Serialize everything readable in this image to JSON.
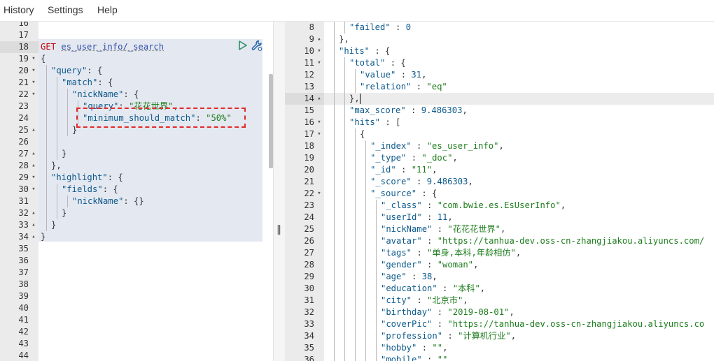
{
  "menu": {
    "history": "History",
    "settings": "Settings",
    "help": "Help"
  },
  "icons": {
    "run": "play-icon",
    "settings": "wrench-icon",
    "resize": "drag-handle-icon"
  },
  "colors": {
    "method": "#c5060b",
    "key": "#0d5a8c",
    "string": "#1e7d1e",
    "highlight_border": "#e12b2b"
  },
  "request": {
    "method": "GET",
    "path": "es_user_info/_search",
    "lines": [
      {
        "n": "16",
        "fold": "",
        "indent": 0,
        "guides": [],
        "parts": []
      },
      {
        "n": "17",
        "fold": "",
        "indent": 0,
        "guides": [],
        "parts": []
      },
      {
        "n": "18",
        "fold": "",
        "indent": 0,
        "guides": [],
        "active": true,
        "parts": [
          {
            "t": "GET",
            "c": "method"
          },
          {
            "t": " ",
            "c": "pun"
          },
          {
            "t": "es_user_info/_search",
            "c": "url"
          }
        ]
      },
      {
        "n": "19",
        "fold": "▾",
        "indent": 0,
        "guides": [],
        "parts": [
          {
            "t": "{",
            "c": "pun"
          }
        ]
      },
      {
        "n": "20",
        "fold": "▾",
        "indent": 1,
        "guides": [
          0
        ],
        "parts": [
          {
            "t": "\"query\"",
            "c": "key"
          },
          {
            "t": ": {",
            "c": "pun"
          }
        ]
      },
      {
        "n": "21",
        "fold": "▾",
        "indent": 2,
        "guides": [
          0,
          1
        ],
        "parts": [
          {
            "t": "\"match\"",
            "c": "key"
          },
          {
            "t": ": {",
            "c": "pun"
          }
        ]
      },
      {
        "n": "22",
        "fold": "▾",
        "indent": 3,
        "guides": [
          0,
          1,
          2
        ],
        "parts": [
          {
            "t": "\"nickName\"",
            "c": "key"
          },
          {
            "t": ": {",
            "c": "pun"
          }
        ]
      },
      {
        "n": "23",
        "fold": "",
        "indent": 4,
        "guides": [
          0,
          1,
          2,
          3
        ],
        "parts": [
          {
            "t": "\"query\"",
            "c": "key"
          },
          {
            "t": ": ",
            "c": "pun"
          },
          {
            "t": "\"花花世界\"",
            "c": "str"
          },
          {
            "t": ",",
            "c": "pun"
          }
        ]
      },
      {
        "n": "24",
        "fold": "",
        "indent": 4,
        "guides": [
          0,
          1,
          2,
          3
        ],
        "parts": [
          {
            "t": "\"minimum_should_match\"",
            "c": "key"
          },
          {
            "t": ": ",
            "c": "pun"
          },
          {
            "t": "\"50%\"",
            "c": "str"
          }
        ]
      },
      {
        "n": "25",
        "fold": "▴",
        "indent": 3,
        "guides": [
          0,
          1,
          2
        ],
        "parts": [
          {
            "t": "}",
            "c": "pun"
          }
        ]
      },
      {
        "n": "26",
        "fold": "",
        "indent": 0,
        "guides": [
          0,
          1
        ],
        "parts": []
      },
      {
        "n": "27",
        "fold": "▴",
        "indent": 2,
        "guides": [
          0,
          1
        ],
        "parts": [
          {
            "t": "}",
            "c": "pun"
          }
        ]
      },
      {
        "n": "28",
        "fold": "▴",
        "indent": 1,
        "guides": [
          0
        ],
        "parts": [
          {
            "t": "},",
            "c": "pun"
          }
        ]
      },
      {
        "n": "29",
        "fold": "▾",
        "indent": 1,
        "guides": [
          0
        ],
        "parts": [
          {
            "t": "\"highlight\"",
            "c": "key"
          },
          {
            "t": ": {",
            "c": "pun"
          }
        ]
      },
      {
        "n": "30",
        "fold": "▾",
        "indent": 2,
        "guides": [
          0,
          1
        ],
        "parts": [
          {
            "t": "\"fields\"",
            "c": "key"
          },
          {
            "t": ": {",
            "c": "pun"
          }
        ]
      },
      {
        "n": "31",
        "fold": "",
        "indent": 3,
        "guides": [
          0,
          1,
          2
        ],
        "parts": [
          {
            "t": "\"nickName\"",
            "c": "key"
          },
          {
            "t": ": {}",
            "c": "pun"
          }
        ]
      },
      {
        "n": "32",
        "fold": "▴",
        "indent": 2,
        "guides": [
          0,
          1
        ],
        "parts": [
          {
            "t": "}",
            "c": "pun"
          }
        ]
      },
      {
        "n": "33",
        "fold": "▴",
        "indent": 1,
        "guides": [
          0
        ],
        "parts": [
          {
            "t": "}",
            "c": "pun"
          }
        ]
      },
      {
        "n": "34",
        "fold": "▴",
        "indent": 0,
        "guides": [],
        "parts": [
          {
            "t": "}",
            "c": "pun"
          }
        ]
      },
      {
        "n": "35",
        "fold": "",
        "indent": 0,
        "guides": [],
        "parts": []
      },
      {
        "n": "36",
        "fold": "",
        "indent": 0,
        "guides": [],
        "parts": []
      },
      {
        "n": "37",
        "fold": "",
        "indent": 0,
        "guides": [],
        "parts": []
      },
      {
        "n": "38",
        "fold": "",
        "indent": 0,
        "guides": [],
        "parts": []
      },
      {
        "n": "39",
        "fold": "",
        "indent": 0,
        "guides": [],
        "parts": []
      },
      {
        "n": "40",
        "fold": "",
        "indent": 0,
        "guides": [],
        "parts": []
      },
      {
        "n": "41",
        "fold": "",
        "indent": 0,
        "guides": [],
        "parts": []
      },
      {
        "n": "42",
        "fold": "",
        "indent": 0,
        "guides": [],
        "parts": []
      },
      {
        "n": "43",
        "fold": "",
        "indent": 0,
        "guides": [],
        "parts": []
      },
      {
        "n": "44",
        "fold": "",
        "indent": 0,
        "guides": [],
        "parts": []
      }
    ]
  },
  "response": {
    "lines": [
      {
        "n": "8",
        "fold": "",
        "indent": 2,
        "guides": [
          0,
          1
        ],
        "parts": [
          {
            "t": "\"failed\"",
            "c": "key"
          },
          {
            "t": " : ",
            "c": "pun"
          },
          {
            "t": "0",
            "c": "num"
          }
        ]
      },
      {
        "n": "9",
        "fold": "▴",
        "indent": 1,
        "guides": [
          0
        ],
        "parts": [
          {
            "t": "},",
            "c": "pun"
          }
        ]
      },
      {
        "n": "10",
        "fold": "▾",
        "indent": 1,
        "guides": [
          0
        ],
        "parts": [
          {
            "t": "\"hits\"",
            "c": "key"
          },
          {
            "t": " : {",
            "c": "pun"
          }
        ]
      },
      {
        "n": "11",
        "fold": "▾",
        "indent": 2,
        "guides": [
          0,
          1
        ],
        "parts": [
          {
            "t": "\"total\"",
            "c": "key"
          },
          {
            "t": " : {",
            "c": "pun"
          }
        ]
      },
      {
        "n": "12",
        "fold": "",
        "indent": 3,
        "guides": [
          0,
          1,
          2
        ],
        "parts": [
          {
            "t": "\"value\"",
            "c": "key"
          },
          {
            "t": " : ",
            "c": "pun"
          },
          {
            "t": "31",
            "c": "num"
          },
          {
            "t": ",",
            "c": "pun"
          }
        ]
      },
      {
        "n": "13",
        "fold": "",
        "indent": 3,
        "guides": [
          0,
          1,
          2
        ],
        "parts": [
          {
            "t": "\"relation\"",
            "c": "key"
          },
          {
            "t": " : ",
            "c": "pun"
          },
          {
            "t": "\"eq\"",
            "c": "str"
          }
        ]
      },
      {
        "n": "14",
        "fold": "▴",
        "indent": 2,
        "guides": [
          0,
          1
        ],
        "active": true,
        "parts": [
          {
            "t": "},",
            "c": "pun"
          }
        ]
      },
      {
        "n": "15",
        "fold": "",
        "indent": 2,
        "guides": [
          0,
          1
        ],
        "parts": [
          {
            "t": "\"max_score\"",
            "c": "key"
          },
          {
            "t": " : ",
            "c": "pun"
          },
          {
            "t": "9.486303",
            "c": "num"
          },
          {
            "t": ",",
            "c": "pun"
          }
        ]
      },
      {
        "n": "16",
        "fold": "▾",
        "indent": 2,
        "guides": [
          0,
          1
        ],
        "parts": [
          {
            "t": "\"hits\"",
            "c": "key"
          },
          {
            "t": " : [",
            "c": "pun"
          }
        ]
      },
      {
        "n": "17",
        "fold": "▾",
        "indent": 3,
        "guides": [
          0,
          1,
          2
        ],
        "parts": [
          {
            "t": "{",
            "c": "pun"
          }
        ]
      },
      {
        "n": "18",
        "fold": "",
        "indent": 4,
        "guides": [
          0,
          1,
          2,
          3
        ],
        "parts": [
          {
            "t": "\"_index\"",
            "c": "key"
          },
          {
            "t": " : ",
            "c": "pun"
          },
          {
            "t": "\"es_user_info\"",
            "c": "str"
          },
          {
            "t": ",",
            "c": "pun"
          }
        ]
      },
      {
        "n": "19",
        "fold": "",
        "indent": 4,
        "guides": [
          0,
          1,
          2,
          3
        ],
        "parts": [
          {
            "t": "\"_type\"",
            "c": "key"
          },
          {
            "t": " : ",
            "c": "pun"
          },
          {
            "t": "\"_doc\"",
            "c": "str"
          },
          {
            "t": ",",
            "c": "pun"
          }
        ]
      },
      {
        "n": "20",
        "fold": "",
        "indent": 4,
        "guides": [
          0,
          1,
          2,
          3
        ],
        "parts": [
          {
            "t": "\"_id\"",
            "c": "key"
          },
          {
            "t": " : ",
            "c": "pun"
          },
          {
            "t": "\"11\"",
            "c": "str"
          },
          {
            "t": ",",
            "c": "pun"
          }
        ]
      },
      {
        "n": "21",
        "fold": "",
        "indent": 4,
        "guides": [
          0,
          1,
          2,
          3
        ],
        "parts": [
          {
            "t": "\"_score\"",
            "c": "key"
          },
          {
            "t": " : ",
            "c": "pun"
          },
          {
            "t": "9.486303",
            "c": "num"
          },
          {
            "t": ",",
            "c": "pun"
          }
        ]
      },
      {
        "n": "22",
        "fold": "▾",
        "indent": 4,
        "guides": [
          0,
          1,
          2,
          3
        ],
        "parts": [
          {
            "t": "\"_source\"",
            "c": "key"
          },
          {
            "t": " : {",
            "c": "pun"
          }
        ]
      },
      {
        "n": "23",
        "fold": "",
        "indent": 5,
        "guides": [
          0,
          1,
          2,
          3,
          4
        ],
        "parts": [
          {
            "t": "\"_class\"",
            "c": "key"
          },
          {
            "t": " : ",
            "c": "pun"
          },
          {
            "t": "\"com.bwie.es.EsUserInfo\"",
            "c": "str"
          },
          {
            "t": ",",
            "c": "pun"
          }
        ]
      },
      {
        "n": "24",
        "fold": "",
        "indent": 5,
        "guides": [
          0,
          1,
          2,
          3,
          4
        ],
        "parts": [
          {
            "t": "\"userId\"",
            "c": "key"
          },
          {
            "t": " : ",
            "c": "pun"
          },
          {
            "t": "11",
            "c": "num"
          },
          {
            "t": ",",
            "c": "pun"
          }
        ]
      },
      {
        "n": "25",
        "fold": "",
        "indent": 5,
        "guides": [
          0,
          1,
          2,
          3,
          4
        ],
        "parts": [
          {
            "t": "\"nickName\"",
            "c": "key"
          },
          {
            "t": " : ",
            "c": "pun"
          },
          {
            "t": "\"花花花世界\"",
            "c": "str"
          },
          {
            "t": ",",
            "c": "pun"
          }
        ]
      },
      {
        "n": "26",
        "fold": "",
        "indent": 5,
        "guides": [
          0,
          1,
          2,
          3,
          4
        ],
        "parts": [
          {
            "t": "\"avatar\"",
            "c": "key"
          },
          {
            "t": " : ",
            "c": "pun"
          },
          {
            "t": "\"https://tanhua-dev.oss-cn-zhangjiakou.aliyuncs.com/",
            "c": "str"
          }
        ]
      },
      {
        "n": "27",
        "fold": "",
        "indent": 5,
        "guides": [
          0,
          1,
          2,
          3,
          4
        ],
        "parts": [
          {
            "t": "\"tags\"",
            "c": "key"
          },
          {
            "t": " : ",
            "c": "pun"
          },
          {
            "t": "\"单身,本科,年龄相仿\"",
            "c": "str"
          },
          {
            "t": ",",
            "c": "pun"
          }
        ]
      },
      {
        "n": "28",
        "fold": "",
        "indent": 5,
        "guides": [
          0,
          1,
          2,
          3,
          4
        ],
        "parts": [
          {
            "t": "\"gender\"",
            "c": "key"
          },
          {
            "t": " : ",
            "c": "pun"
          },
          {
            "t": "\"woman\"",
            "c": "str"
          },
          {
            "t": ",",
            "c": "pun"
          }
        ]
      },
      {
        "n": "29",
        "fold": "",
        "indent": 5,
        "guides": [
          0,
          1,
          2,
          3,
          4
        ],
        "parts": [
          {
            "t": "\"age\"",
            "c": "key"
          },
          {
            "t": " : ",
            "c": "pun"
          },
          {
            "t": "38",
            "c": "num"
          },
          {
            "t": ",",
            "c": "pun"
          }
        ]
      },
      {
        "n": "30",
        "fold": "",
        "indent": 5,
        "guides": [
          0,
          1,
          2,
          3,
          4
        ],
        "parts": [
          {
            "t": "\"education\"",
            "c": "key"
          },
          {
            "t": " : ",
            "c": "pun"
          },
          {
            "t": "\"本科\"",
            "c": "str"
          },
          {
            "t": ",",
            "c": "pun"
          }
        ]
      },
      {
        "n": "31",
        "fold": "",
        "indent": 5,
        "guides": [
          0,
          1,
          2,
          3,
          4
        ],
        "parts": [
          {
            "t": "\"city\"",
            "c": "key"
          },
          {
            "t": " : ",
            "c": "pun"
          },
          {
            "t": "\"北京市\"",
            "c": "str"
          },
          {
            "t": ",",
            "c": "pun"
          }
        ]
      },
      {
        "n": "32",
        "fold": "",
        "indent": 5,
        "guides": [
          0,
          1,
          2,
          3,
          4
        ],
        "parts": [
          {
            "t": "\"birthday\"",
            "c": "key"
          },
          {
            "t": " : ",
            "c": "pun"
          },
          {
            "t": "\"2019-08-01\"",
            "c": "str"
          },
          {
            "t": ",",
            "c": "pun"
          }
        ]
      },
      {
        "n": "33",
        "fold": "",
        "indent": 5,
        "guides": [
          0,
          1,
          2,
          3,
          4
        ],
        "parts": [
          {
            "t": "\"coverPic\"",
            "c": "key"
          },
          {
            "t": " : ",
            "c": "pun"
          },
          {
            "t": "\"https://tanhua-dev.oss-cn-zhangjiakou.aliyuncs.co",
            "c": "str"
          }
        ]
      },
      {
        "n": "34",
        "fold": "",
        "indent": 5,
        "guides": [
          0,
          1,
          2,
          3,
          4
        ],
        "parts": [
          {
            "t": "\"profession\"",
            "c": "key"
          },
          {
            "t": " : ",
            "c": "pun"
          },
          {
            "t": "\"计算机行业\"",
            "c": "str"
          },
          {
            "t": ",",
            "c": "pun"
          }
        ]
      },
      {
        "n": "35",
        "fold": "",
        "indent": 5,
        "guides": [
          0,
          1,
          2,
          3,
          4
        ],
        "parts": [
          {
            "t": "\"hobby\"",
            "c": "key"
          },
          {
            "t": " : ",
            "c": "pun"
          },
          {
            "t": "\"\"",
            "c": "str"
          },
          {
            "t": ",",
            "c": "pun"
          }
        ]
      },
      {
        "n": "36",
        "fold": "",
        "indent": 5,
        "guides": [
          0,
          1,
          2,
          3,
          4
        ],
        "parts": [
          {
            "t": "\"mobile\"",
            "c": "key"
          },
          {
            "t": " : ",
            "c": "pun"
          },
          {
            "t": "\"\"",
            "c": "str"
          }
        ]
      }
    ]
  }
}
